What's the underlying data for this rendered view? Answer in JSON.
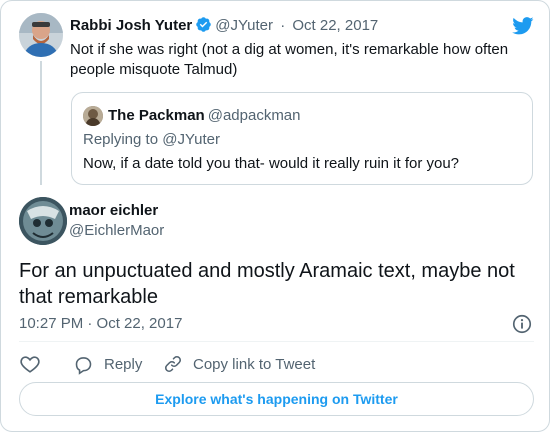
{
  "parent_tweet": {
    "author_name": "Rabbi Josh Yuter",
    "handle": "@JYuter",
    "separator": "·",
    "date": "Oct 22, 2017",
    "text": "Not if she was right (not a dig at women, it's remarkable how often people misquote Talmud)",
    "verified": true
  },
  "quoted_tweet": {
    "author_name": "The Packman",
    "handle": "@adpackman",
    "replying_to": "Replying to @JYuter",
    "text": "Now, if a date told you that- would it really ruin it for you?"
  },
  "main_tweet": {
    "author_name": "maor eichler",
    "handle": "@EichlerMaor",
    "text": "For an unpuctuated and mostly Aramaic text, maybe not that remarkable",
    "timestamp": "10:27 PM · Oct 22, 2017"
  },
  "actions": {
    "like_icon": "heart-icon",
    "reply_label": "Reply",
    "copy_link_label": "Copy link to Tweet"
  },
  "footer": {
    "explore_label": "Explore what's happening on Twitter"
  },
  "colors": {
    "brand_blue": "#1d9bf0",
    "secondary_text": "#536471",
    "border": "#cfd9de"
  }
}
